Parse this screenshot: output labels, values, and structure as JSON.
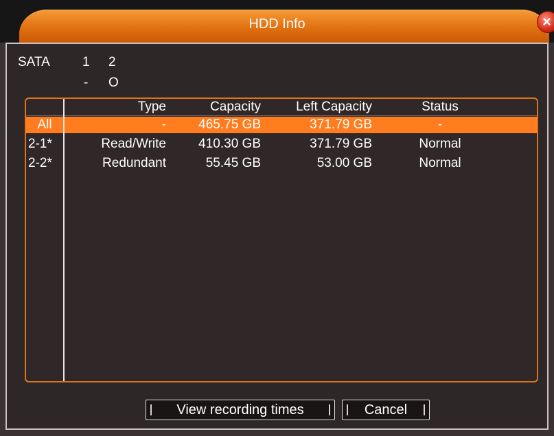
{
  "window": {
    "title": "HDD Info",
    "close_symbol": "×"
  },
  "sata": {
    "label": "SATA",
    "ports": [
      "1",
      "2"
    ],
    "states": [
      "-",
      "O"
    ]
  },
  "table": {
    "headers": {
      "index": "",
      "type": "Type",
      "capacity": "Capacity",
      "left_capacity": "Left Capacity",
      "status": "Status"
    },
    "rows": [
      {
        "index": "All",
        "type": "-",
        "capacity": "465.75 GB",
        "left_capacity": "371.79 GB",
        "status": "-",
        "selected": true
      },
      {
        "index": "2-1*",
        "type": "Read/Write",
        "capacity": "410.30 GB",
        "left_capacity": "371.79 GB",
        "status": "Normal",
        "selected": false
      },
      {
        "index": "2-2*",
        "type": "Redundant",
        "capacity": "55.45 GB",
        "left_capacity": "53.00 GB",
        "status": "Normal",
        "selected": false
      }
    ]
  },
  "buttons": {
    "view_recording_times": "View recording times",
    "cancel": "Cancel"
  },
  "colors": {
    "accent": "#ff7d1f",
    "title_gradient_top": "#f59a36",
    "panel_bg": "#2e2727",
    "close_red": "#d42a17"
  }
}
